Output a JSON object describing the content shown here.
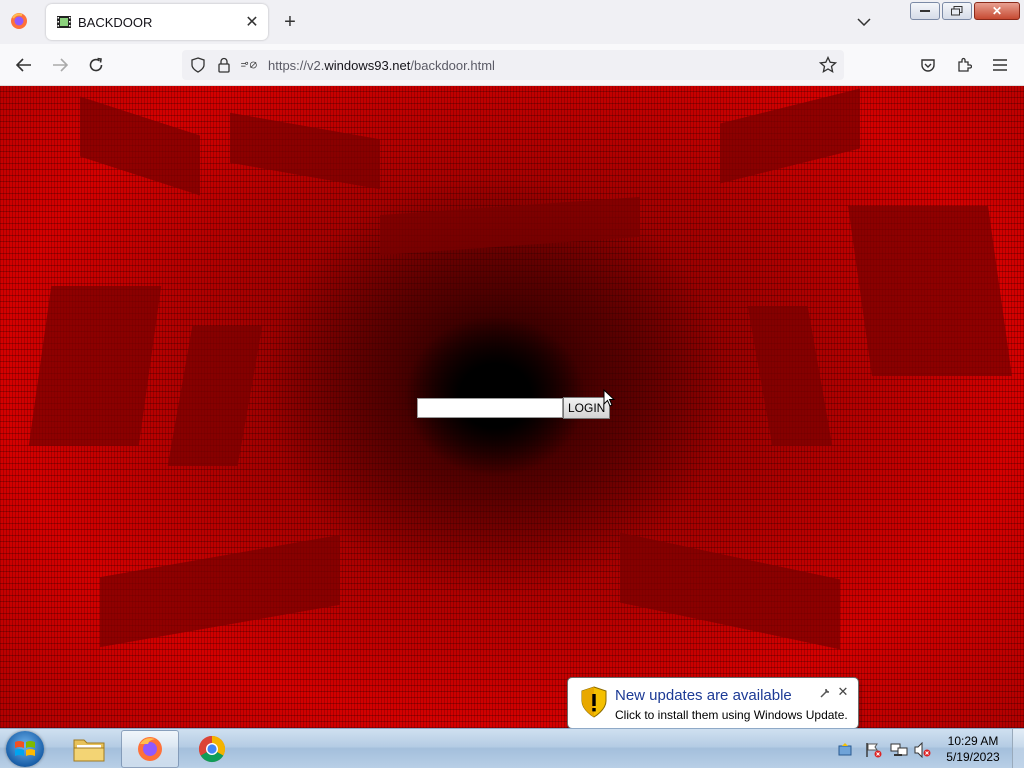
{
  "browser": {
    "tab": {
      "title": "BACKDOOR"
    },
    "url": {
      "prefix": "https://v2.",
      "domain": "windows93.net",
      "path": "/backdoor.html"
    }
  },
  "page": {
    "login": {
      "input_value": "",
      "button_label": "LOGIN"
    }
  },
  "notification": {
    "title": "New updates are available",
    "message": "Click to install them using Windows Update."
  },
  "taskbar": {
    "apps": [
      "file-explorer",
      "firefox",
      "chrome"
    ],
    "clock": {
      "time": "10:29 AM",
      "date": "5/19/2023"
    }
  },
  "colors": {
    "tunnel_red": "#d40000",
    "notification_title": "#1c3a95"
  }
}
